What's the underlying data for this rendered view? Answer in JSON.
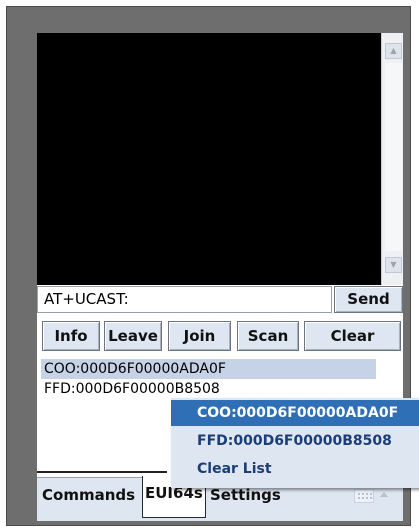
{
  "command": {
    "input_value": "AT+UCAST:",
    "send_label": "Send"
  },
  "actions": {
    "info": "Info",
    "leave": "Leave",
    "join": "Join",
    "scan": "Scan",
    "clear": "Clear"
  },
  "eui_list": {
    "items": [
      "COO:000D6F00000ADA0F",
      "FFD:000D6F00000B8508"
    ],
    "selected_index": 0
  },
  "context_menu": {
    "items": [
      "COO:000D6F00000ADA0F",
      "FFD:000D6F00000B8508",
      "Clear List"
    ],
    "highlighted_index": 0
  },
  "tabs": {
    "commands": "Commands",
    "eui64s": "EUI64s",
    "settings": "Settings",
    "active": "eui64s"
  },
  "icons": {
    "scroll_up": "scroll-up-arrow",
    "scroll_down": "scroll-down-arrow",
    "keyboard": "keyboard-icon",
    "sip_toggle": "up-arrow-icon"
  },
  "colors": {
    "console_background": "#000000",
    "button_face": "#dde6f1",
    "selection": "#2f6fb6",
    "list_selection": "#c6d3e6",
    "menu_text": "#1c3d78"
  }
}
